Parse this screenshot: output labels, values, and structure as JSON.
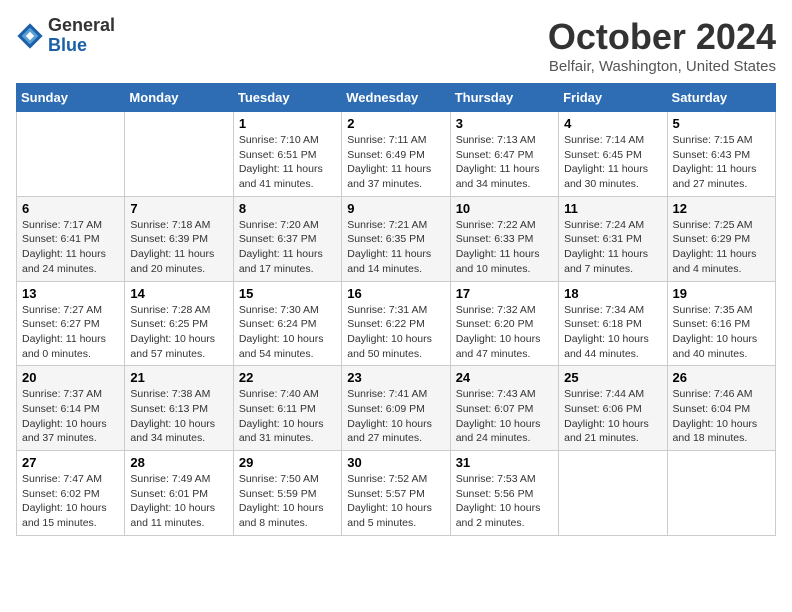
{
  "logo": {
    "general": "General",
    "blue": "Blue"
  },
  "title": "October 2024",
  "location": "Belfair, Washington, United States",
  "days_of_week": [
    "Sunday",
    "Monday",
    "Tuesday",
    "Wednesday",
    "Thursday",
    "Friday",
    "Saturday"
  ],
  "weeks": [
    [
      {
        "day": "",
        "details": ""
      },
      {
        "day": "",
        "details": ""
      },
      {
        "day": "1",
        "sunrise": "Sunrise: 7:10 AM",
        "sunset": "Sunset: 6:51 PM",
        "daylight": "Daylight: 11 hours and 41 minutes."
      },
      {
        "day": "2",
        "sunrise": "Sunrise: 7:11 AM",
        "sunset": "Sunset: 6:49 PM",
        "daylight": "Daylight: 11 hours and 37 minutes."
      },
      {
        "day": "3",
        "sunrise": "Sunrise: 7:13 AM",
        "sunset": "Sunset: 6:47 PM",
        "daylight": "Daylight: 11 hours and 34 minutes."
      },
      {
        "day": "4",
        "sunrise": "Sunrise: 7:14 AM",
        "sunset": "Sunset: 6:45 PM",
        "daylight": "Daylight: 11 hours and 30 minutes."
      },
      {
        "day": "5",
        "sunrise": "Sunrise: 7:15 AM",
        "sunset": "Sunset: 6:43 PM",
        "daylight": "Daylight: 11 hours and 27 minutes."
      }
    ],
    [
      {
        "day": "6",
        "sunrise": "Sunrise: 7:17 AM",
        "sunset": "Sunset: 6:41 PM",
        "daylight": "Daylight: 11 hours and 24 minutes."
      },
      {
        "day": "7",
        "sunrise": "Sunrise: 7:18 AM",
        "sunset": "Sunset: 6:39 PM",
        "daylight": "Daylight: 11 hours and 20 minutes."
      },
      {
        "day": "8",
        "sunrise": "Sunrise: 7:20 AM",
        "sunset": "Sunset: 6:37 PM",
        "daylight": "Daylight: 11 hours and 17 minutes."
      },
      {
        "day": "9",
        "sunrise": "Sunrise: 7:21 AM",
        "sunset": "Sunset: 6:35 PM",
        "daylight": "Daylight: 11 hours and 14 minutes."
      },
      {
        "day": "10",
        "sunrise": "Sunrise: 7:22 AM",
        "sunset": "Sunset: 6:33 PM",
        "daylight": "Daylight: 11 hours and 10 minutes."
      },
      {
        "day": "11",
        "sunrise": "Sunrise: 7:24 AM",
        "sunset": "Sunset: 6:31 PM",
        "daylight": "Daylight: 11 hours and 7 minutes."
      },
      {
        "day": "12",
        "sunrise": "Sunrise: 7:25 AM",
        "sunset": "Sunset: 6:29 PM",
        "daylight": "Daylight: 11 hours and 4 minutes."
      }
    ],
    [
      {
        "day": "13",
        "sunrise": "Sunrise: 7:27 AM",
        "sunset": "Sunset: 6:27 PM",
        "daylight": "Daylight: 11 hours and 0 minutes."
      },
      {
        "day": "14",
        "sunrise": "Sunrise: 7:28 AM",
        "sunset": "Sunset: 6:25 PM",
        "daylight": "Daylight: 10 hours and 57 minutes."
      },
      {
        "day": "15",
        "sunrise": "Sunrise: 7:30 AM",
        "sunset": "Sunset: 6:24 PM",
        "daylight": "Daylight: 10 hours and 54 minutes."
      },
      {
        "day": "16",
        "sunrise": "Sunrise: 7:31 AM",
        "sunset": "Sunset: 6:22 PM",
        "daylight": "Daylight: 10 hours and 50 minutes."
      },
      {
        "day": "17",
        "sunrise": "Sunrise: 7:32 AM",
        "sunset": "Sunset: 6:20 PM",
        "daylight": "Daylight: 10 hours and 47 minutes."
      },
      {
        "day": "18",
        "sunrise": "Sunrise: 7:34 AM",
        "sunset": "Sunset: 6:18 PM",
        "daylight": "Daylight: 10 hours and 44 minutes."
      },
      {
        "day": "19",
        "sunrise": "Sunrise: 7:35 AM",
        "sunset": "Sunset: 6:16 PM",
        "daylight": "Daylight: 10 hours and 40 minutes."
      }
    ],
    [
      {
        "day": "20",
        "sunrise": "Sunrise: 7:37 AM",
        "sunset": "Sunset: 6:14 PM",
        "daylight": "Daylight: 10 hours and 37 minutes."
      },
      {
        "day": "21",
        "sunrise": "Sunrise: 7:38 AM",
        "sunset": "Sunset: 6:13 PM",
        "daylight": "Daylight: 10 hours and 34 minutes."
      },
      {
        "day": "22",
        "sunrise": "Sunrise: 7:40 AM",
        "sunset": "Sunset: 6:11 PM",
        "daylight": "Daylight: 10 hours and 31 minutes."
      },
      {
        "day": "23",
        "sunrise": "Sunrise: 7:41 AM",
        "sunset": "Sunset: 6:09 PM",
        "daylight": "Daylight: 10 hours and 27 minutes."
      },
      {
        "day": "24",
        "sunrise": "Sunrise: 7:43 AM",
        "sunset": "Sunset: 6:07 PM",
        "daylight": "Daylight: 10 hours and 24 minutes."
      },
      {
        "day": "25",
        "sunrise": "Sunrise: 7:44 AM",
        "sunset": "Sunset: 6:06 PM",
        "daylight": "Daylight: 10 hours and 21 minutes."
      },
      {
        "day": "26",
        "sunrise": "Sunrise: 7:46 AM",
        "sunset": "Sunset: 6:04 PM",
        "daylight": "Daylight: 10 hours and 18 minutes."
      }
    ],
    [
      {
        "day": "27",
        "sunrise": "Sunrise: 7:47 AM",
        "sunset": "Sunset: 6:02 PM",
        "daylight": "Daylight: 10 hours and 15 minutes."
      },
      {
        "day": "28",
        "sunrise": "Sunrise: 7:49 AM",
        "sunset": "Sunset: 6:01 PM",
        "daylight": "Daylight: 10 hours and 11 minutes."
      },
      {
        "day": "29",
        "sunrise": "Sunrise: 7:50 AM",
        "sunset": "Sunset: 5:59 PM",
        "daylight": "Daylight: 10 hours and 8 minutes."
      },
      {
        "day": "30",
        "sunrise": "Sunrise: 7:52 AM",
        "sunset": "Sunset: 5:57 PM",
        "daylight": "Daylight: 10 hours and 5 minutes."
      },
      {
        "day": "31",
        "sunrise": "Sunrise: 7:53 AM",
        "sunset": "Sunset: 5:56 PM",
        "daylight": "Daylight: 10 hours and 2 minutes."
      },
      {
        "day": "",
        "details": ""
      },
      {
        "day": "",
        "details": ""
      }
    ]
  ]
}
